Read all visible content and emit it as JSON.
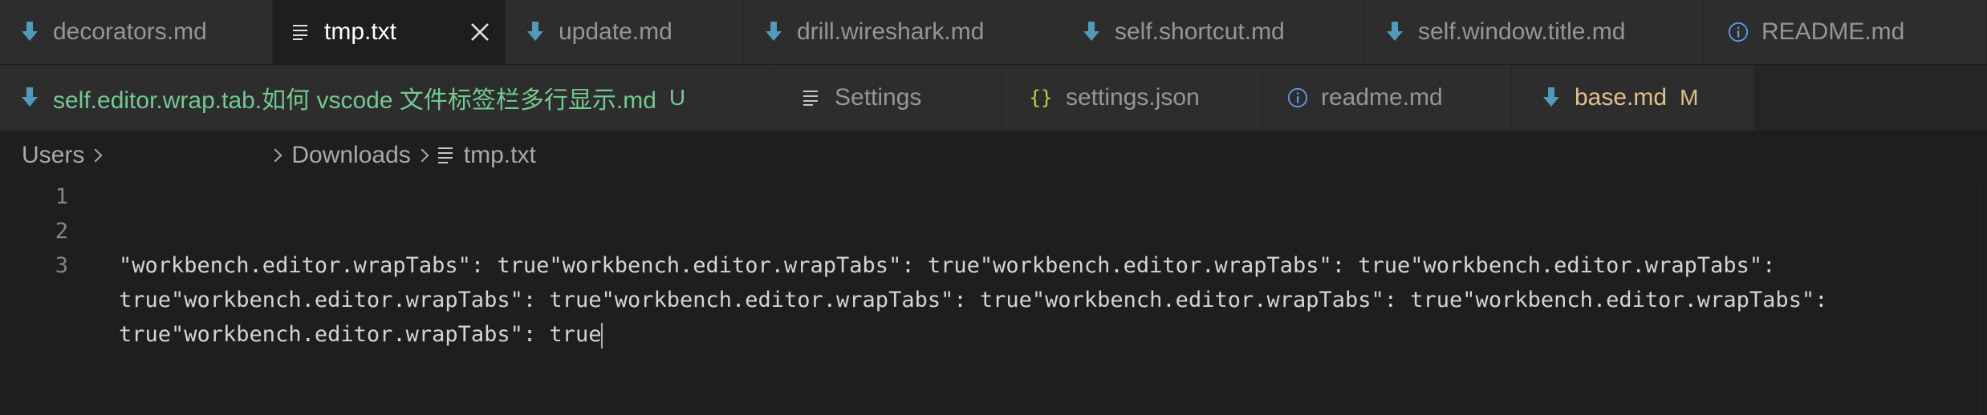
{
  "colors": {
    "tab_bg": "#2d2d2d",
    "active_tab_bg": "#1e1e1e",
    "tab_text": "#969696",
    "modified_green": "#73c991",
    "modified_orange": "#e2c08d",
    "download_icon_blue": "#519aba",
    "info_icon_blue": "#6796e6",
    "json_icon_yellow": "#cbcb41"
  },
  "tabs_row1": [
    {
      "label": "decorators.md",
      "icon": "download-arrow-icon"
    },
    {
      "label": "tmp.txt",
      "icon": "file-lines-icon",
      "active": true
    },
    {
      "label": "update.md",
      "icon": "download-arrow-icon"
    },
    {
      "label": "drill.wireshark.md",
      "icon": "download-arrow-icon"
    },
    {
      "label": "self.shortcut.md",
      "icon": "download-arrow-icon"
    },
    {
      "label": "self.window.title.md",
      "icon": "download-arrow-icon"
    },
    {
      "label": "README.md",
      "icon": "info-icon"
    }
  ],
  "tabs_row2": [
    {
      "label": "self.editor.wrap.tab.如何 vscode 文件标签栏多行显示.md",
      "icon": "download-arrow-icon",
      "badge": "U"
    },
    {
      "label": "Settings",
      "icon": "file-lines-icon"
    },
    {
      "label": "settings.json",
      "icon": "braces-icon",
      "glyph": "{}"
    },
    {
      "label": "readme.md",
      "icon": "info-icon"
    },
    {
      "label": "base.md",
      "icon": "download-arrow-icon",
      "badge": "M"
    }
  ],
  "breadcrumb": {
    "items": [
      "Users",
      "Downloads",
      "tmp.txt"
    ]
  },
  "editor": {
    "line_numbers": [
      "1",
      "2",
      "3"
    ],
    "line3_wrapped": [
      "\"workbench.editor.wrapTabs\": true\"workbench.editor.wrapTabs\": true\"workbench.editor.wrapTabs\": true\"workbench.editor.wrapTabs\":",
      "true\"workbench.editor.wrapTabs\": true\"workbench.editor.wrapTabs\": true\"workbench.editor.wrapTabs\": true\"workbench.editor.wrapTabs\":",
      "true\"workbench.editor.wrapTabs\": true"
    ]
  }
}
